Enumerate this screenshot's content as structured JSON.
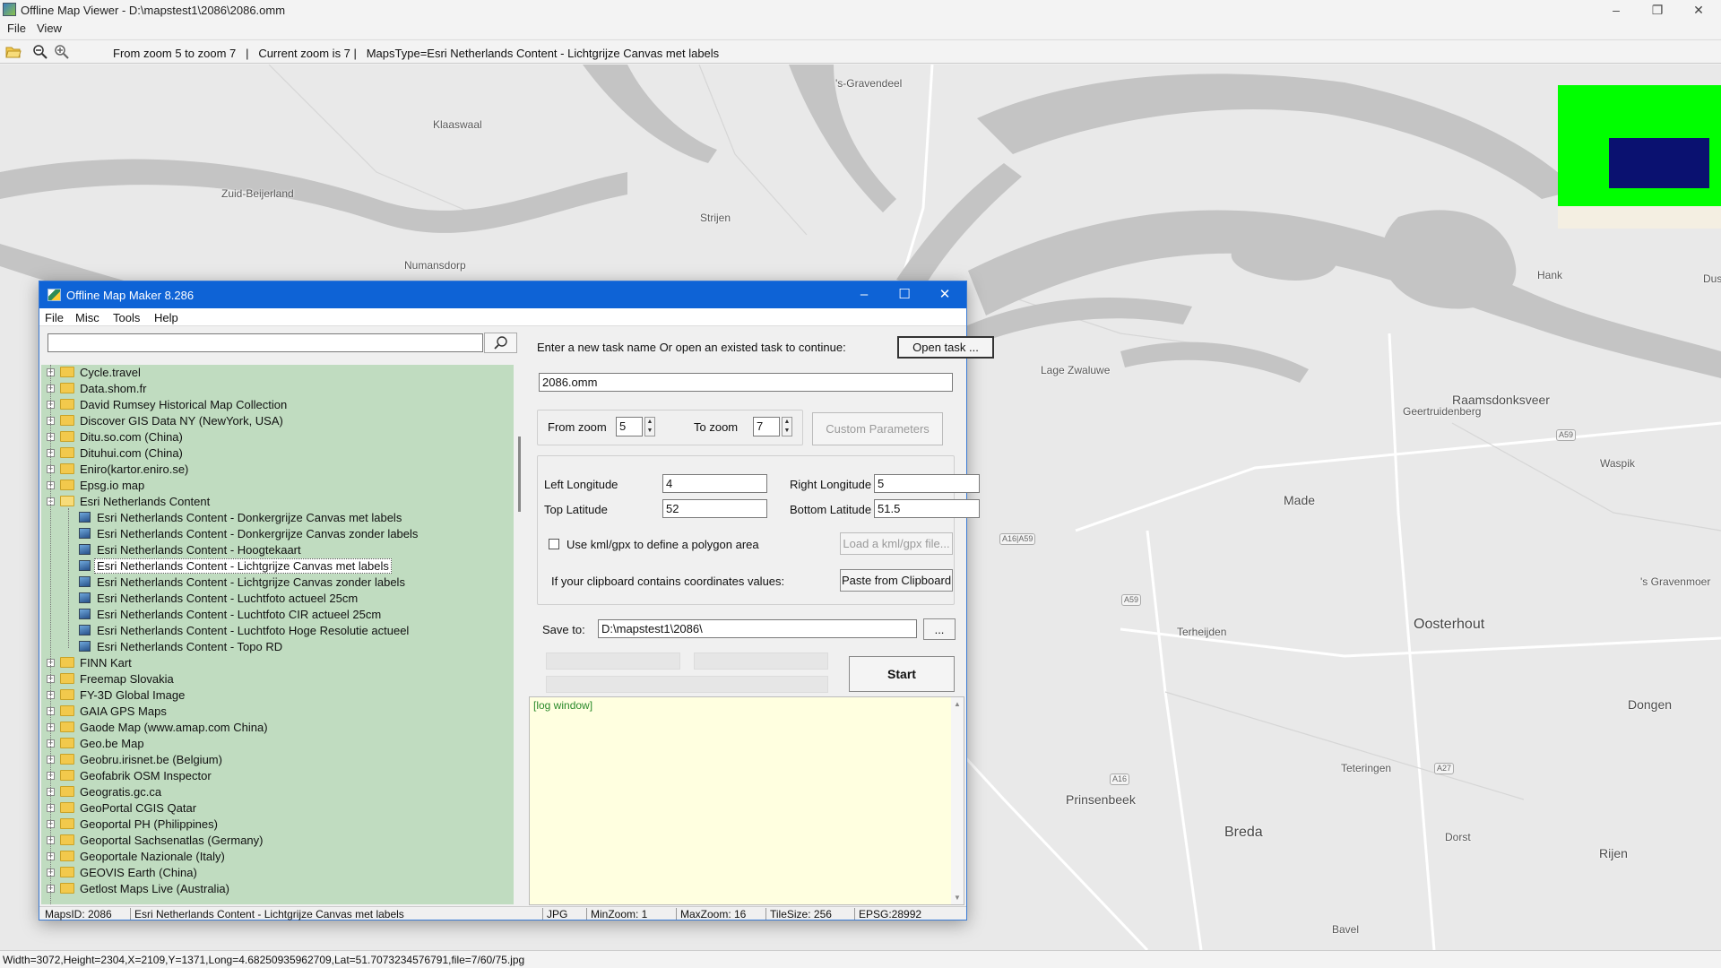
{
  "viewer": {
    "title": "Offline Map Viewer - D:\\mapstest1\\2086\\2086.omm",
    "menu": [
      "File",
      "View"
    ],
    "toolbar_info": "From zoom 5 to zoom 7   |   Current zoom is 7 |   MapsType=Esri Netherlands Content - Lichtgrijze Canvas met labels",
    "status": "Width=3072,Height=2304,X=2109,Y=1371,Long=4.68250935962709,Lat=51.7073234576791,file=7/60/75.jpg"
  },
  "map": {
    "places": {
      "gravendeel": "'s-Gravendeel",
      "klaaswaal": "Klaaswaal",
      "zuid_beijerland": "Zuid-Beijerland",
      "strijen": "Strijen",
      "numansdorp": "Numansdorp",
      "hank": "Hank",
      "dus": "Dus",
      "lage_zwaluwe": "Lage Zwaluwe",
      "raamsdonksveer": "Raamsdonksveer",
      "geertruidenberg": "Geertruidenberg",
      "made": "Made",
      "waspik": "Waspik",
      "gravenmoer": "'s Gravenmoer",
      "terheijden": "Terheijden",
      "oosterhout": "Oosterhout",
      "dongen": "Dongen",
      "teteringen": "Teteringen",
      "prinsenbeek": "Prinsenbeek",
      "breda": "Breda",
      "dorst": "Dorst",
      "rijen": "Rijen",
      "bavel": "Bavel"
    },
    "shields": {
      "a59_east": "A59",
      "a16a59": "A16|A59",
      "a59_south": "A59",
      "a27": "A27",
      "a16": "A16"
    }
  },
  "maker": {
    "title": "Offline Map Maker 8.286",
    "menu": [
      "File",
      "Misc",
      "Tools",
      "Help"
    ],
    "search_value": "",
    "tree": [
      {
        "label": "Cycle.travel",
        "type": "folder"
      },
      {
        "label": "Data.shom.fr",
        "type": "folder"
      },
      {
        "label": "David Rumsey Historical Map Collection",
        "type": "folder"
      },
      {
        "label": "Discover GIS Data NY (NewYork, USA)",
        "type": "folder"
      },
      {
        "label": "Ditu.so.com (China)",
        "type": "folder"
      },
      {
        "label": "Dituhui.com (China)",
        "type": "folder"
      },
      {
        "label": "Eniro(kartor.eniro.se)",
        "type": "folder"
      },
      {
        "label": "Epsg.io map",
        "type": "folder"
      },
      {
        "label": "Esri Netherlands Content",
        "type": "open"
      },
      {
        "label": "Esri Netherlands Content - Donkergrijze Canvas met labels",
        "type": "child"
      },
      {
        "label": "Esri Netherlands Content - Donkergrijze Canvas zonder labels",
        "type": "child"
      },
      {
        "label": "Esri Netherlands Content - Hoogtekaart",
        "type": "child"
      },
      {
        "label": "Esri Netherlands Content - Lichtgrijze Canvas met labels",
        "type": "child",
        "selected": true
      },
      {
        "label": "Esri Netherlands Content - Lichtgrijze Canvas zonder labels",
        "type": "child"
      },
      {
        "label": "Esri Netherlands Content - Luchtfoto actueel 25cm",
        "type": "child"
      },
      {
        "label": "Esri Netherlands Content - Luchtfoto CIR actueel 25cm",
        "type": "child"
      },
      {
        "label": "Esri Netherlands Content - Luchtfoto Hoge Resolutie actueel",
        "type": "child"
      },
      {
        "label": "Esri Netherlands Content - Topo RD",
        "type": "child"
      },
      {
        "label": "FINN Kart",
        "type": "folder"
      },
      {
        "label": "Freemap Slovakia",
        "type": "folder"
      },
      {
        "label": "FY-3D Global Image",
        "type": "folder"
      },
      {
        "label": "GAIA GPS Maps",
        "type": "folder"
      },
      {
        "label": "Gaode Map (www.amap.com China)",
        "type": "folder"
      },
      {
        "label": "Geo.be Map",
        "type": "folder"
      },
      {
        "label": "Geobru.irisnet.be (Belgium)",
        "type": "folder"
      },
      {
        "label": "Geofabrik OSM Inspector",
        "type": "folder"
      },
      {
        "label": "Geogratis.gc.ca",
        "type": "folder"
      },
      {
        "label": "GeoPortal CGIS Qatar",
        "type": "folder"
      },
      {
        "label": "Geoportal PH (Philippines)",
        "type": "folder"
      },
      {
        "label": "Geoportal Sachsenatlas (Germany)",
        "type": "folder"
      },
      {
        "label": "Geoportale Nazionale (Italy)",
        "type": "folder"
      },
      {
        "label": "GEOVIS Earth (China)",
        "type": "folder"
      },
      {
        "label": "Getlost Maps Live (Australia)",
        "type": "folder"
      }
    ],
    "task_prompt": "Enter a new task name Or open an existed task to continue:",
    "open_task_label": "Open task ...",
    "task_name": "2086.omm",
    "from_zoom_label": "From zoom",
    "from_zoom": "5",
    "to_zoom_label": "To zoom",
    "to_zoom": "7",
    "custom_params_label": "Custom Parameters",
    "left_lon_label": "Left Longitude",
    "left_lon": "4",
    "right_lon_label": "Right Longitude",
    "right_lon": "5",
    "top_lat_label": "Top Latitude",
    "top_lat": "52",
    "bottom_lat_label": "Bottom Latitude",
    "bottom_lat": "51.5",
    "kml_label": "Use kml/gpx to define a polygon area",
    "load_kml_label": "Load a kml/gpx file...",
    "clipboard_prompt": "If your clipboard contains coordinates values:",
    "paste_label": "Paste from Clipboard",
    "save_to_label": "Save to:",
    "save_to": "D:\\mapstest1\\2086\\",
    "browse_label": "...",
    "start_label": "Start",
    "log_text": "[log window]",
    "status": {
      "maps_id": "MapsID: 2086",
      "maps_name": "Esri Netherlands Content - Lichtgrijze Canvas met labels",
      "format": "JPG",
      "min_zoom": "MinZoom: 1",
      "max_zoom": "MaxZoom: 16",
      "tile_size": "TileSize: 256",
      "epsg": "EPSG:28992"
    }
  }
}
